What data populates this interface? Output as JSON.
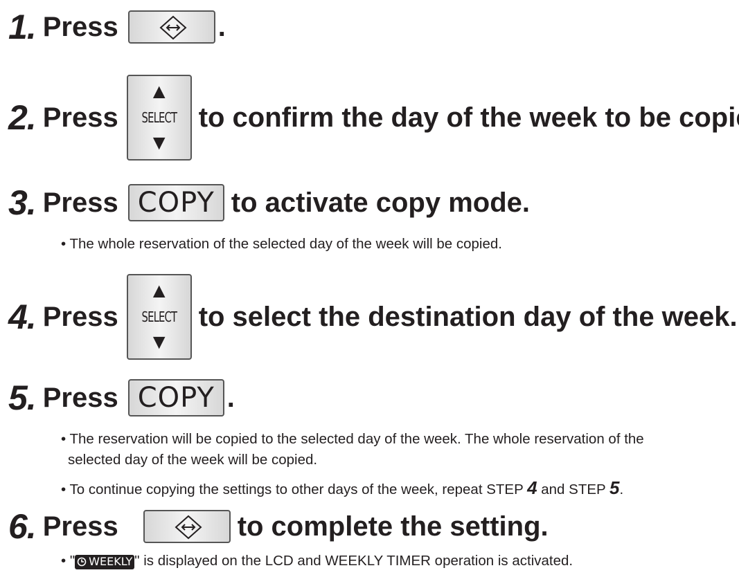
{
  "steps": [
    {
      "num": "1.",
      "press": "Press",
      "tail": "."
    },
    {
      "num": "2.",
      "press": "Press",
      "select_label": "SELECT",
      "tail": "to confirm the day of the week to be copied."
    },
    {
      "num": "3.",
      "press": "Press",
      "copy_label": "COPY",
      "tail": "to activate copy mode."
    },
    {
      "num": "4.",
      "press": "Press",
      "select_label": "SELECT",
      "tail": "to select the destination day of the week."
    },
    {
      "num": "5.",
      "press": "Press",
      "copy_label": "COPY",
      "tail": "."
    },
    {
      "num": "6.",
      "press": "Press",
      "tail": "to complete the setting."
    }
  ],
  "notes": {
    "step3": "• The whole reservation of the selected day of the week will be copied.",
    "step5_a1": "• The reservation will be copied to the selected day of the week. The whole reservation of the",
    "step5_a2": "selected day of the week will be copied.",
    "step5_b_pre": "• To continue copying the settings to other days of the week, repeat STEP ",
    "step5_b_n1": "4",
    "step5_b_mid": " and STEP ",
    "step5_b_n2": "5",
    "step5_b_end": ".",
    "step6_pre": "• \"",
    "step6_badge": "WEEKLY",
    "step6_post": "\" is displayed on the LCD and WEEKLY TIMER operation is activated."
  },
  "icons": {
    "enter": "enter-diamond-icon",
    "up": "triangle-up-icon",
    "down": "triangle-down-icon",
    "clock": "clock-icon"
  }
}
